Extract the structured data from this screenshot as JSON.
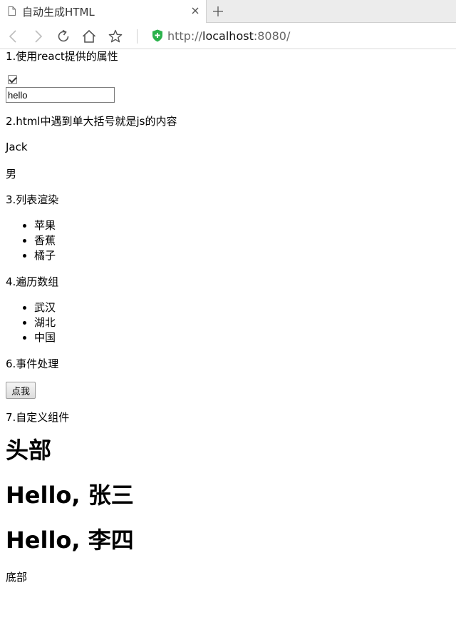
{
  "browser": {
    "tab_title": "自动生成HTML",
    "url_scheme": "http://",
    "url_host": "localhost",
    "url_rest": ":8080/",
    "colors": {
      "shield": "#2bb24c",
      "tab_bg": "#ffffff",
      "tabbar_bg": "#ececec"
    },
    "icons": [
      "page-icon",
      "close-icon",
      "plus-icon",
      "back-icon",
      "forward-icon",
      "reload-icon",
      "home-icon",
      "star-icon",
      "shield-icon"
    ]
  },
  "page": {
    "s1_title": "1.使用react提供的属性",
    "checkbox_checked": true,
    "input_value": "hello",
    "s2_title": "2.html中遇到单大括号就是js的内容",
    "name": "Jack",
    "gender": "男",
    "s3_title": "3.列表渲染",
    "fruits": [
      "苹果",
      "香蕉",
      "橘子"
    ],
    "s4_title": "4.遍历数组",
    "places": [
      "武汉",
      "湖北",
      "中国"
    ],
    "s6_title": "6.事件处理",
    "button_label": "点我",
    "s7_title": "7.自定义组件",
    "header_text": "头部",
    "greetings": [
      "Hello, 张三",
      "Hello, 李四"
    ],
    "footer_text": "底部"
  }
}
